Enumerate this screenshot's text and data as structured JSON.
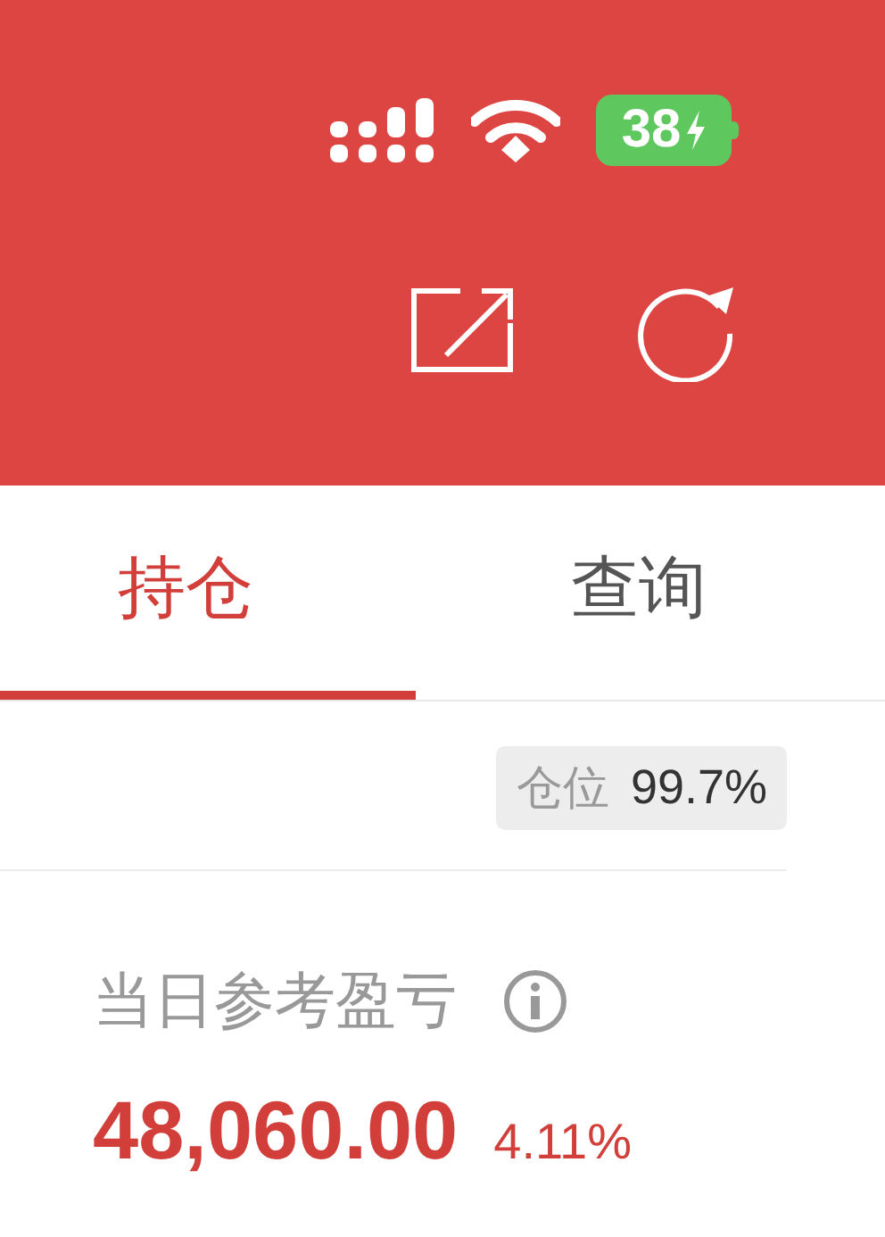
{
  "status_bar": {
    "battery": "38",
    "charging": true
  },
  "tabs": [
    {
      "label": "持仓",
      "selected": true
    },
    {
      "label": "查询",
      "selected": false
    }
  ],
  "position_badge": {
    "label": "仓位",
    "value": "99.7%"
  },
  "daily_pnl": {
    "label": "当日参考盈亏",
    "amount": "48,060.00",
    "percent": "4.11%"
  }
}
